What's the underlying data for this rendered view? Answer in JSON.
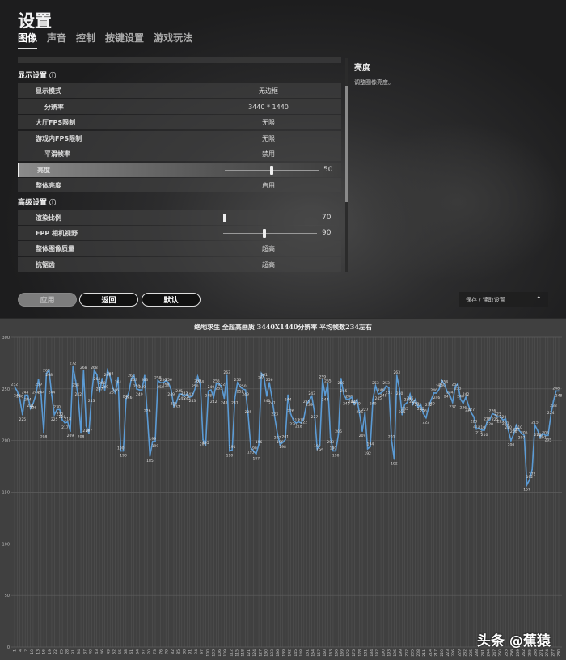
{
  "game": {
    "title": "设置",
    "tabs": [
      "图像",
      "声音",
      "控制",
      "按键设置",
      "游戏玩法"
    ],
    "display_section": "显示设置",
    "advanced_section": "高级设置",
    "info_icon": "info-circle-icon",
    "rows": [
      {
        "label": "显示模式",
        "value": "无边框"
      },
      {
        "label": "分辨率",
        "value": "3440 * 1440"
      },
      {
        "label": "大厅FPS限制",
        "value": "无限"
      },
      {
        "label": "游戏内FPS限制",
        "value": "无限"
      },
      {
        "label": "平滑帧率",
        "value": "禁用"
      },
      {
        "label": "亮度",
        "value": "50",
        "slider_fraction": 0.5
      },
      {
        "label": "整体亮度",
        "value": "启用"
      },
      {
        "label": "渲染比例",
        "value": "70",
        "slider_fraction": 0.0
      },
      {
        "label": "FPP 相机视野",
        "value": "90",
        "slider_fraction": 0.44
      },
      {
        "label": "整体图像质量",
        "value": "超高"
      },
      {
        "label": "抗锯齿",
        "value": "超高"
      }
    ],
    "help_title": "亮度",
    "help_desc": "调整图像亮度。",
    "buttons": {
      "apply": "应用",
      "back": "返回",
      "default": "默认"
    },
    "save_load": "保存 / 读取设置",
    "chevron_icon": "chevron-up-icon"
  },
  "watermark": "头条 @蕉猿",
  "chart_data": {
    "type": "line",
    "title": "绝地求生 全超高画质 3440X1440分辨率 平均帧数234左右",
    "xlabel": "",
    "ylabel": "",
    "ylim": [
      0,
      300
    ],
    "yticks": [
      0,
      50,
      100,
      150,
      200,
      250,
      300
    ],
    "xtick_start": 1,
    "xtick_step": 3,
    "xtick_end": 280,
    "grid": true,
    "color": "#5b9bd5",
    "values": [
      252,
      248,
      240,
      225,
      244,
      244,
      231,
      236,
      244,
      259,
      244,
      208,
      265,
      268,
      244,
      225,
      230,
      230,
      220,
      217,
      218,
      209,
      272,
      258,
      242,
      208,
      268,
      214,
      207,
      243,
      268,
      264,
      247,
      260,
      249,
      268,
      262,
      251,
      246,
      261,
      190,
      190,
      240,
      246,
      260,
      263,
      250,
      249,
      249,
      263,
      226,
      185,
      199,
      199,
      258,
      256,
      256,
      258,
      256,
      249,
      233,
      237,
      245,
      245,
      243,
      245,
      242,
      243,
      250,
      262,
      254,
      201,
      195,
      248,
      249,
      242,
      255,
      255,
      252,
      241,
      263,
      190,
      191,
      241,
      256,
      252,
      250,
      249,
      225,
      193,
      190,
      187,
      196,
      265,
      261,
      243,
      256,
      241,
      223,
      207,
      196,
      198,
      201,
      244,
      226,
      220,
      217,
      218,
      217,
      222,
      235,
      239,
      243,
      227,
      192,
      195,
      259,
      244,
      255,
      203,
      190,
      190,
      206,
      260,
      245,
      240,
      240,
      242,
      235,
      240,
      225,
      209,
      227,
      192,
      194,
      240,
      253,
      245,
      246,
      248,
      253,
      251,
      201,
      182,
      263,
      250,
      225,
      235,
      237,
      245,
      235,
      240,
      232,
      235,
      226,
      222,
      232,
      240,
      246,
      246,
      250,
      258,
      254,
      247,
      244,
      237,
      252,
      255,
      240,
      236,
      242,
      234,
      227,
      223,
      211,
      212,
      210,
      210,
      218,
      220,
      226,
      225,
      223,
      223,
      220,
      221,
      210,
      200,
      206,
      215,
      210,
      207,
      205,
      157,
      162,
      172,
      215,
      210,
      203,
      207,
      205,
      205,
      224,
      238,
      248,
      248
    ]
  }
}
